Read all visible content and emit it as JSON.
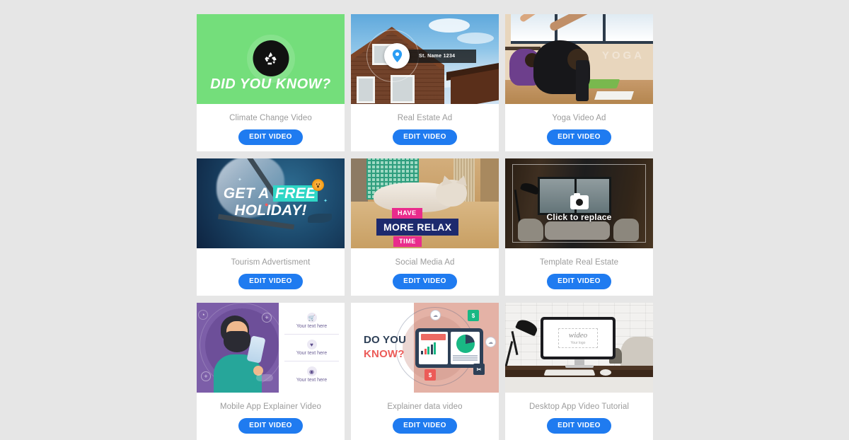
{
  "page": {
    "background_color": "#e6e6e6",
    "button_color": "#1f7bf0",
    "label_color": "#9b9b9b"
  },
  "common": {
    "edit_button_label": "EDIT VIDEO"
  },
  "cards": [
    {
      "id": "climate-change-video",
      "label": "Climate Change Video",
      "edit_label": "EDIT VIDEO",
      "thumb": {
        "kind": "graphic",
        "background_color": "#74de7b",
        "icon": "recycle-icon",
        "headline": "DID YOU KNOW?"
      }
    },
    {
      "id": "real-estate-ad",
      "label": "Real Estate Ad",
      "edit_label": "EDIT VIDEO",
      "thumb": {
        "kind": "photo",
        "description": "wooden house exterior with blue sky",
        "icon": "location-pin-icon",
        "address_text": "St. Name 1234"
      }
    },
    {
      "id": "yoga-video-ad",
      "label": "Yoga Video Ad",
      "edit_label": "EDIT VIDEO",
      "thumb": {
        "kind": "photo",
        "description": "people stretching in a yoga class",
        "watermark": "YOGA"
      }
    },
    {
      "id": "tourism-advertisment",
      "label": "Tourism Advertisment",
      "edit_label": "EDIT VIDEO",
      "thumb": {
        "kind": "photo",
        "description": "underwater scuba diving scene",
        "headline_line1_pre": "GET A ",
        "headline_highlight": "FREE",
        "headline_line2": "HOLIDAY!",
        "highlight_color": "#2fd6c6",
        "emoji": "😱"
      }
    },
    {
      "id": "social-media-ad",
      "label": "Social Media Ad",
      "edit_label": "EDIT VIDEO",
      "thumb": {
        "kind": "photo",
        "description": "cat lying on wooden floor",
        "badge_top": "HAVE",
        "banner_main": "MORE RELAX",
        "badge_bottom": "TIME",
        "badge_color": "#e92b8c",
        "banner_color": "#1d2a6e"
      }
    },
    {
      "id": "template-real-estate",
      "label": "Template Real Estate",
      "edit_label": "EDIT VIDEO",
      "thumb": {
        "kind": "photo",
        "description": "modern wooden cabin living room",
        "icon": "camera-icon",
        "overlay_text": "Click to replace"
      }
    },
    {
      "id": "mobile-app-explainer-video",
      "label": "Mobile App Explainer Video",
      "edit_label": "EDIT VIDEO",
      "thumb": {
        "kind": "illustration",
        "description": "bearded man holding a smartphone",
        "rows": [
          {
            "icon": "cart-icon",
            "glyph": "🛒",
            "text": "Your text here"
          },
          {
            "icon": "heart-icon",
            "glyph": "♥",
            "text": "Your text here"
          },
          {
            "icon": "location-pin-icon",
            "glyph": "◉",
            "text": "Your text here"
          }
        ]
      }
    },
    {
      "id": "explainer-data-video",
      "label": "Explainer data video",
      "edit_label": "EDIT VIDEO",
      "thumb": {
        "kind": "illustration",
        "description": "tablet with bar chart and pie chart",
        "title_line1": "DO YOU",
        "title_line2": "KNOW?",
        "title_line1_color": "#2e4057",
        "title_line2_color": "#ec5b58",
        "badges": [
          {
            "name": "dollar-badge-green",
            "glyph": "$",
            "color": "#19b884"
          },
          {
            "name": "dollar-badge-red",
            "glyph": "$",
            "color": "#ec5b58"
          },
          {
            "name": "tag-badge-navy",
            "glyph": "✂",
            "color": "#2e4057"
          }
        ],
        "cloud_icons": [
          "cloud-icon",
          "cloud-icon"
        ]
      }
    },
    {
      "id": "desktop-app-video-tutorial",
      "label": "Desktop App Video Tutorial",
      "edit_label": "EDIT VIDEO",
      "thumb": {
        "kind": "photo",
        "description": "desktop monitor on a wooden desk with lamp",
        "screen_logo": "wideo",
        "screen_sub": "Your logo"
      }
    }
  ]
}
